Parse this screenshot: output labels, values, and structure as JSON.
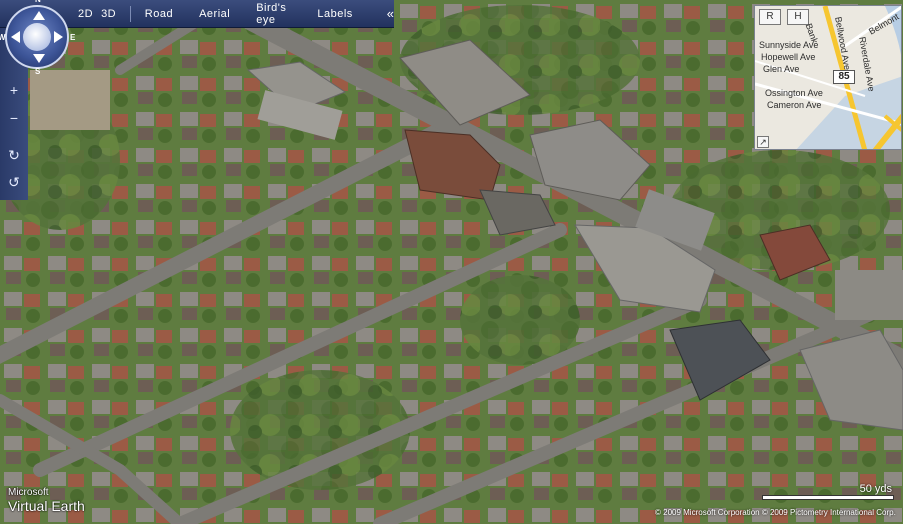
{
  "toolbar": {
    "mode_2d": "2D",
    "mode_3d": "3D",
    "views": [
      "Road",
      "Aerial",
      "Bird's eye",
      "Labels"
    ],
    "collapse": "«"
  },
  "compass": {
    "n": "N",
    "e": "E",
    "s": "S",
    "w": "W"
  },
  "rail": {
    "zoom_in": "+",
    "zoom_out": "−",
    "rotate_cw": "↻",
    "rotate_ccw": "↺"
  },
  "minimap": {
    "btn_r": "R",
    "btn_h": "H",
    "labels": [
      "Sunnyside Ave",
      "Hopewell Ave",
      "Glen Ave",
      "Ossington Ave",
      "Cameron Ave",
      "Bellwood Ave",
      "Riverdale Ave",
      "Belmont",
      "Bank"
    ],
    "shield": "85",
    "expand": "↗"
  },
  "branding": {
    "microsoft": "Microsoft",
    "product": "Virtual Earth"
  },
  "scale": {
    "label": "50 yds"
  },
  "copyright": "© 2009 Microsoft Corporation   © 2009 Pictometry International Corp.",
  "colors": {
    "toolbar": "#2d3d6b",
    "road_yellow": "#f6c630",
    "grass": "#5d7a3d",
    "roof_gray": "#8d8a83",
    "roof_red": "#9b4e3d"
  }
}
